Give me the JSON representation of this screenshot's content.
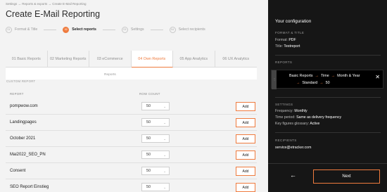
{
  "breadcrumb": "Settings → Reports & exports → Create E-Mail Reporting",
  "page_title": "Create E-Mail Reporting",
  "steps": [
    {
      "num": "01",
      "label": "Format & Title",
      "active": false
    },
    {
      "num": "02",
      "label": "Select reports",
      "active": true
    },
    {
      "num": "03",
      "label": "Settings",
      "active": false
    },
    {
      "num": "04",
      "label": "Select recipients",
      "active": false
    }
  ],
  "tabs": [
    {
      "label": "01 Basic Reports",
      "active": false
    },
    {
      "label": "02 Marketing Reports",
      "active": false
    },
    {
      "label": "03 eCommerce",
      "active": false
    },
    {
      "label": "04 Own Reports",
      "active": true
    },
    {
      "label": "05 App Analytics",
      "active": false
    },
    {
      "label": "06 UX Analytics",
      "active": false
    }
  ],
  "subheader_label": "Reports",
  "custom_report_label": "CUSTOM REPORT",
  "columns": {
    "report": "REPORT",
    "row_count": "ROW COUNT"
  },
  "rows": [
    {
      "name": "pompwow.com",
      "count": "50",
      "action": "Add"
    },
    {
      "name": "Landingpages",
      "count": "50",
      "action": "Add"
    },
    {
      "name": "October 2021",
      "count": "50",
      "action": "Add"
    },
    {
      "name": "Mai2022_SEO_PN",
      "count": "50",
      "action": "Add"
    },
    {
      "name": "Consent",
      "count": "50",
      "action": "Add"
    },
    {
      "name": "SEO Report Einstieg",
      "count": "50",
      "action": "Add"
    }
  ],
  "config": {
    "title": "Your configuration",
    "format_section": "FORMAT & TITLE",
    "format_key": "Format:",
    "format_value": "PDF",
    "title_key": "Title:",
    "title_value": "Testreport",
    "reports_section": "REPORTS",
    "report_item": {
      "part1": "Basic Reports",
      "part2": "Time",
      "part3": "Month & Year",
      "part4": "Standard",
      "part5": "50"
    },
    "settings_section": "SETTINGS",
    "frequency_key": "Frequency:",
    "frequency_value": "Monthly",
    "period_key": "Time period:",
    "period_value": "Same as delivery frequency",
    "glossary_key": "Key figures glossary:",
    "glossary_value": "Active",
    "recipients_section": "RECIPIENTS",
    "recipient": "service@etracker.com",
    "next_label": "Next"
  },
  "colors": {
    "accent": "#ef7b3e",
    "dark_panel": "#161616",
    "left_bg": "#f3f3f3"
  }
}
